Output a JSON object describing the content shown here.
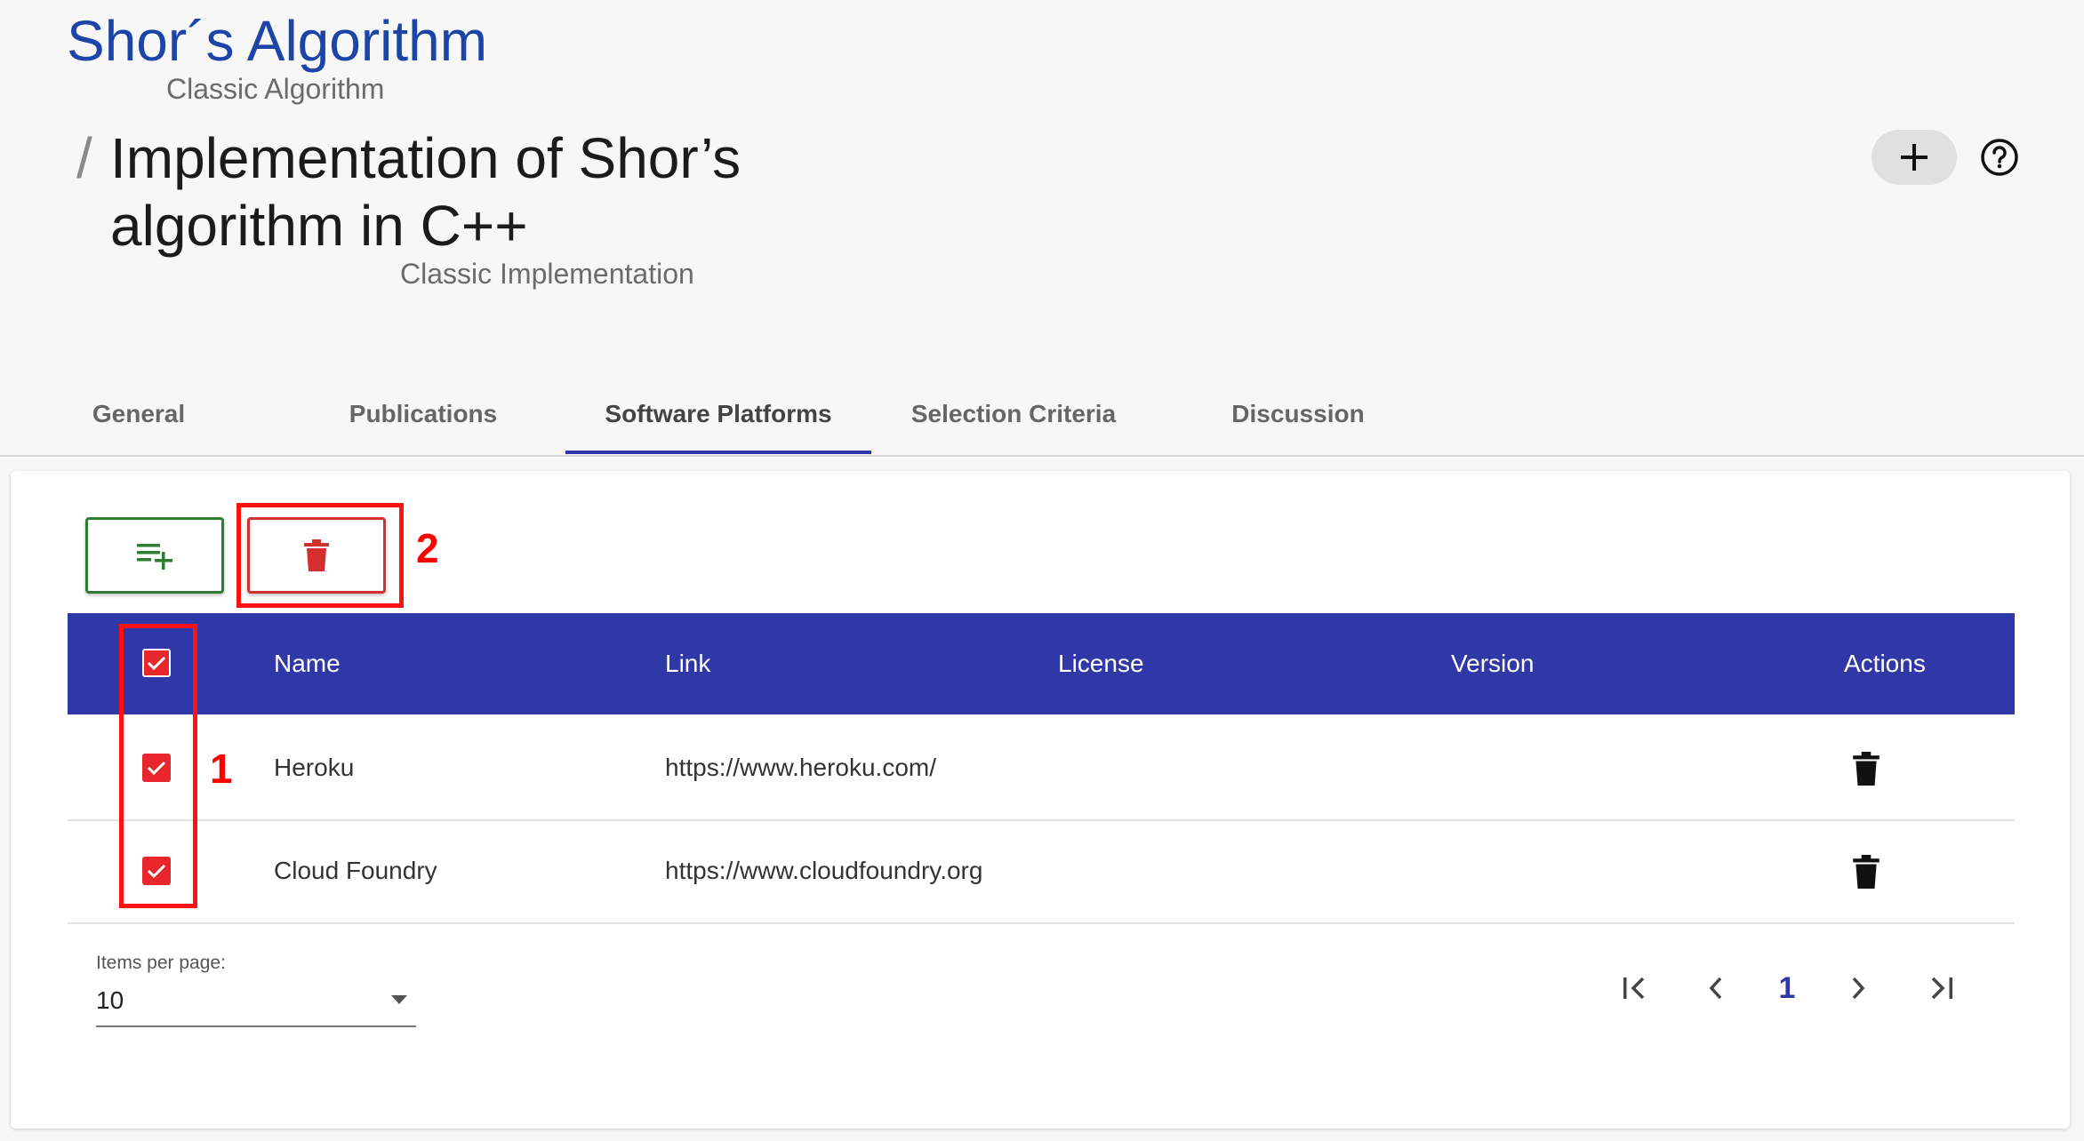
{
  "header": {
    "algorithm_title": "Shor´s Algorithm",
    "algorithm_subtitle": "Classic Algorithm",
    "slash": "/",
    "implementation_title_line1": "Implementation of Shor’s",
    "implementation_title_line2": "algorithm in C++",
    "implementation_subtitle": "Classic Implementation",
    "add_icon": "plus-icon",
    "help_icon": "help-circle-icon"
  },
  "tabs": [
    {
      "label": "General"
    },
    {
      "label": "Publications"
    },
    {
      "label": "Software Platforms",
      "active": true
    },
    {
      "label": "Selection Criteria"
    },
    {
      "label": "Discussion"
    }
  ],
  "toolbar": {
    "add_icon": "playlist-add-icon",
    "delete_icon": "trash-icon"
  },
  "annotations": {
    "marker_1": "1",
    "marker_2": "2",
    "color": "#ff1111"
  },
  "table": {
    "columns": [
      "Name",
      "Link",
      "License",
      "Version",
      "Actions"
    ],
    "header_checked": true,
    "rows": [
      {
        "checked": true,
        "name": "Heroku",
        "link": "https://www.heroku.com/",
        "license": "",
        "version": ""
      },
      {
        "checked": true,
        "name": "Cloud Foundry",
        "link": "https://www.cloudfoundry.org",
        "license": "",
        "version": ""
      }
    ]
  },
  "paginator": {
    "items_per_page_label": "Items per page:",
    "items_per_page_value": "10",
    "current_page": "1"
  },
  "colors": {
    "primary": "#3038a8",
    "title_blue": "#1d45a8",
    "checkbox_red": "#e8262b",
    "add_green": "#2f7d32",
    "delete_red": "#d32f2f"
  }
}
